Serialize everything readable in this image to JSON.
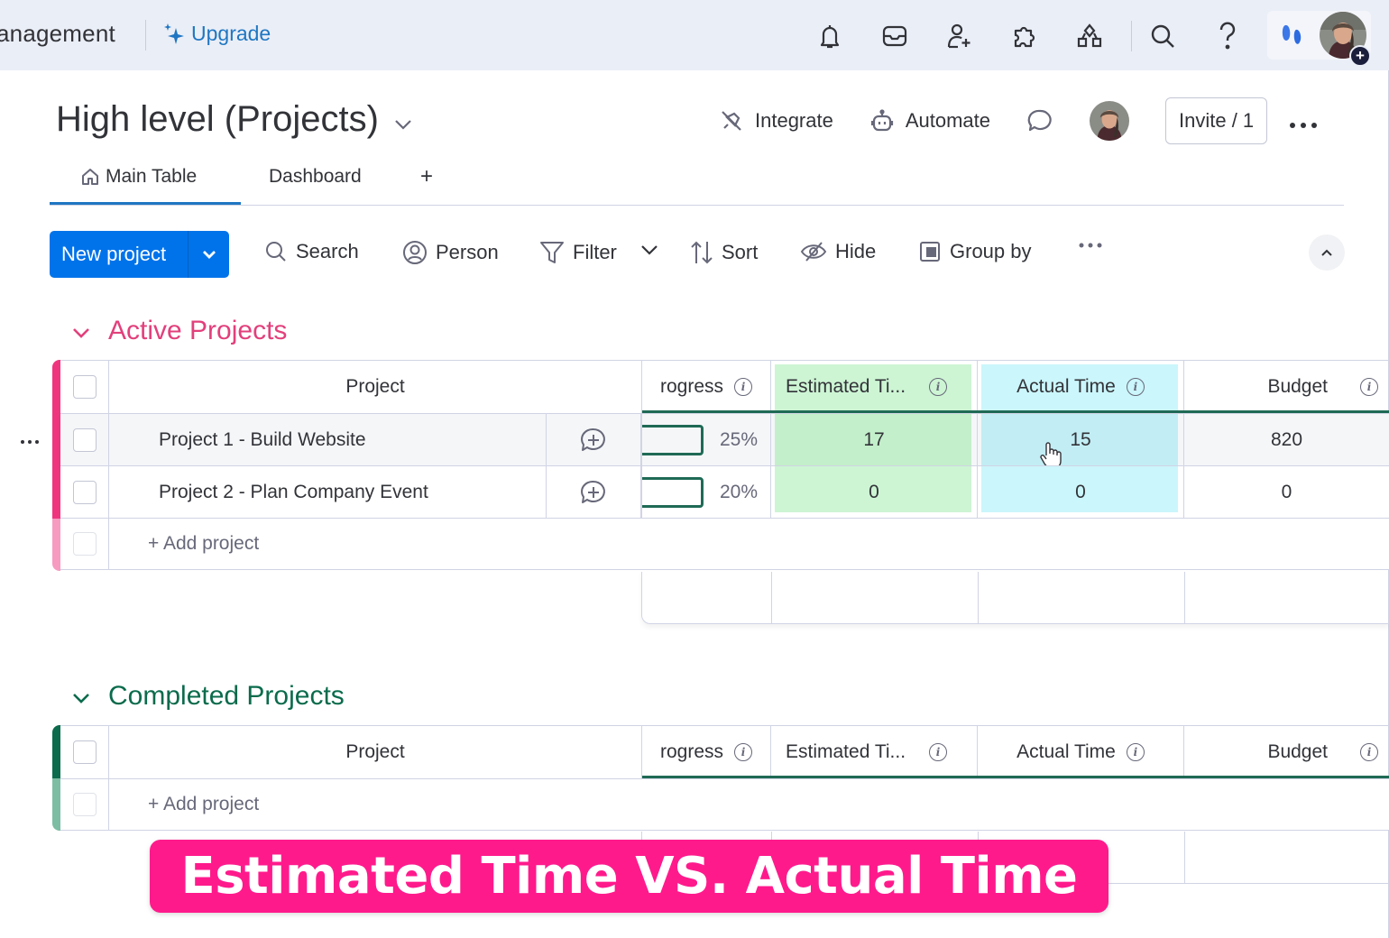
{
  "topbar": {
    "product_name_partial": "anagement",
    "upgrade_label": "Upgrade",
    "icons": [
      "bell-icon",
      "inbox-icon",
      "invite-member-icon",
      "apps-puzzle-icon",
      "integrations-icon",
      "search-icon",
      "help-icon"
    ],
    "accent": "#1f76c2"
  },
  "board": {
    "title": "High level (Projects)",
    "actions": {
      "integrate": "Integrate",
      "automate": "Automate",
      "invite": "Invite / 1"
    },
    "tabs": [
      {
        "label": "Main Table",
        "active": true
      },
      {
        "label": "Dashboard",
        "active": false
      },
      {
        "label": "+",
        "active": false
      }
    ]
  },
  "toolbar": {
    "new_button": "New project",
    "search": "Search",
    "person": "Person",
    "filter": "Filter",
    "sort": "Sort",
    "hide": "Hide",
    "group_by": "Group by",
    "more": "···"
  },
  "columns": {
    "project": "Project",
    "progress": "rogress",
    "estimated": "Estimated Ti...",
    "actual": "Actual Time",
    "budget": "Budget"
  },
  "groups": [
    {
      "name": "Active Projects",
      "color": "#e2445c",
      "accent": "#f0357f",
      "rows": [
        {
          "name": "Project 1 - Build Website",
          "progress": "25%",
          "progress_value": 0.25,
          "estimated": "17",
          "actual": "15",
          "budget": "820"
        },
        {
          "name": "Project 2 - Plan Company Event",
          "progress": "20%",
          "progress_value": 0.2,
          "estimated": "0",
          "actual": "0",
          "budget": "0"
        }
      ],
      "add_label": "+ Add project"
    },
    {
      "name": "Completed Projects",
      "color": "#037f4c",
      "accent": "#0b6b4c",
      "rows": [],
      "add_label": "+ Add project"
    }
  ],
  "row_menu": "···",
  "banner": {
    "text": "Estimated Time VS. Actual Time",
    "color": "#ff1a8c"
  }
}
